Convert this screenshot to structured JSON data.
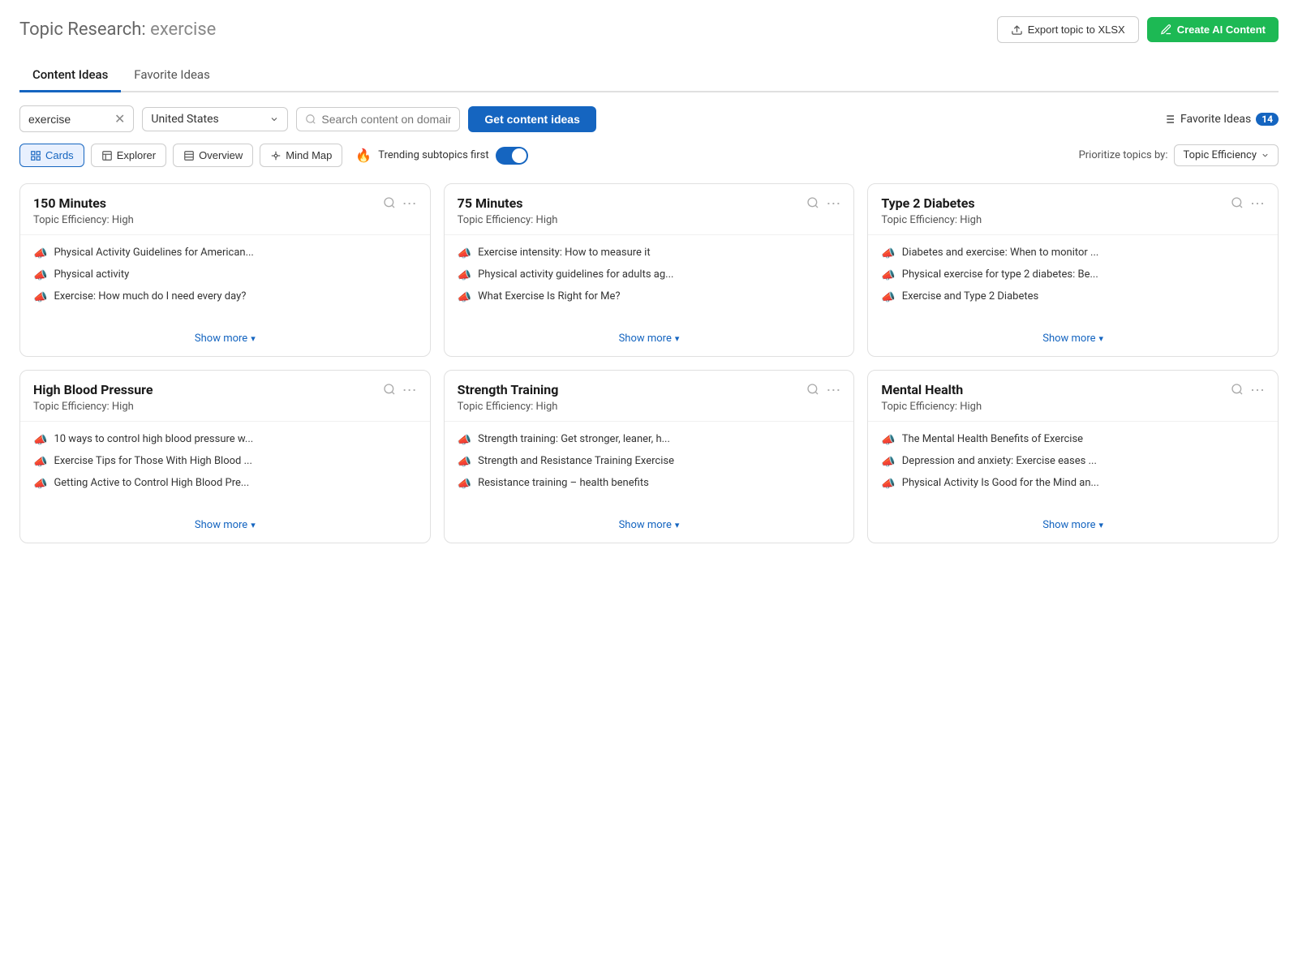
{
  "header": {
    "title_main": "Topic Research:",
    "title_keyword": " exercise",
    "export_label": "Export topic to XLSX",
    "create_label": "Create AI Content"
  },
  "tabs": [
    {
      "label": "Content Ideas",
      "active": true
    },
    {
      "label": "Favorite Ideas",
      "active": false
    }
  ],
  "controls": {
    "keyword_value": "exercise",
    "country_value": "United States",
    "domain_placeholder": "Search content on domain",
    "get_ideas_label": "Get content ideas",
    "favorite_ideas_label": "Favorite Ideas",
    "favorite_count": "14"
  },
  "view_modes": [
    {
      "label": "Cards",
      "active": true,
      "icon": "cards"
    },
    {
      "label": "Explorer",
      "active": false,
      "icon": "explorer"
    },
    {
      "label": "Overview",
      "active": false,
      "icon": "overview"
    },
    {
      "label": "Mind Map",
      "active": false,
      "icon": "mindmap"
    }
  ],
  "trending": {
    "label": "Trending subtopics first",
    "enabled": true
  },
  "prioritize": {
    "label": "Prioritize topics by:",
    "value": "Topic Efficiency"
  },
  "cards": [
    {
      "title": "150 Minutes",
      "efficiency": "Topic Efficiency: High",
      "items": [
        "Physical Activity Guidelines for American...",
        "Physical activity",
        "Exercise: How much do I need every day?"
      ],
      "show_more": "Show more"
    },
    {
      "title": "75 Minutes",
      "efficiency": "Topic Efficiency: High",
      "items": [
        "Exercise intensity: How to measure it",
        "Physical activity guidelines for adults ag...",
        "What Exercise Is Right for Me?"
      ],
      "show_more": "Show more"
    },
    {
      "title": "Type 2 Diabetes",
      "efficiency": "Topic Efficiency: High",
      "items": [
        "Diabetes and exercise: When to monitor ...",
        "Physical exercise for type 2 diabetes: Be...",
        "Exercise and Type 2 Diabetes"
      ],
      "show_more": "Show more"
    },
    {
      "title": "High Blood Pressure",
      "efficiency": "Topic Efficiency: High",
      "items": [
        "10 ways to control high blood pressure w...",
        "Exercise Tips for Those With High Blood ...",
        "Getting Active to Control High Blood Pre..."
      ],
      "show_more": "Show more"
    },
    {
      "title": "Strength Training",
      "efficiency": "Topic Efficiency: High",
      "items": [
        "Strength training: Get stronger, leaner, h...",
        "Strength and Resistance Training Exercise",
        "Resistance training – health benefits"
      ],
      "show_more": "Show more"
    },
    {
      "title": "Mental Health",
      "efficiency": "Topic Efficiency: High",
      "items": [
        "The Mental Health Benefits of Exercise",
        "Depression and anxiety: Exercise eases ...",
        "Physical Activity Is Good for the Mind an..."
      ],
      "show_more": "Show more"
    }
  ]
}
